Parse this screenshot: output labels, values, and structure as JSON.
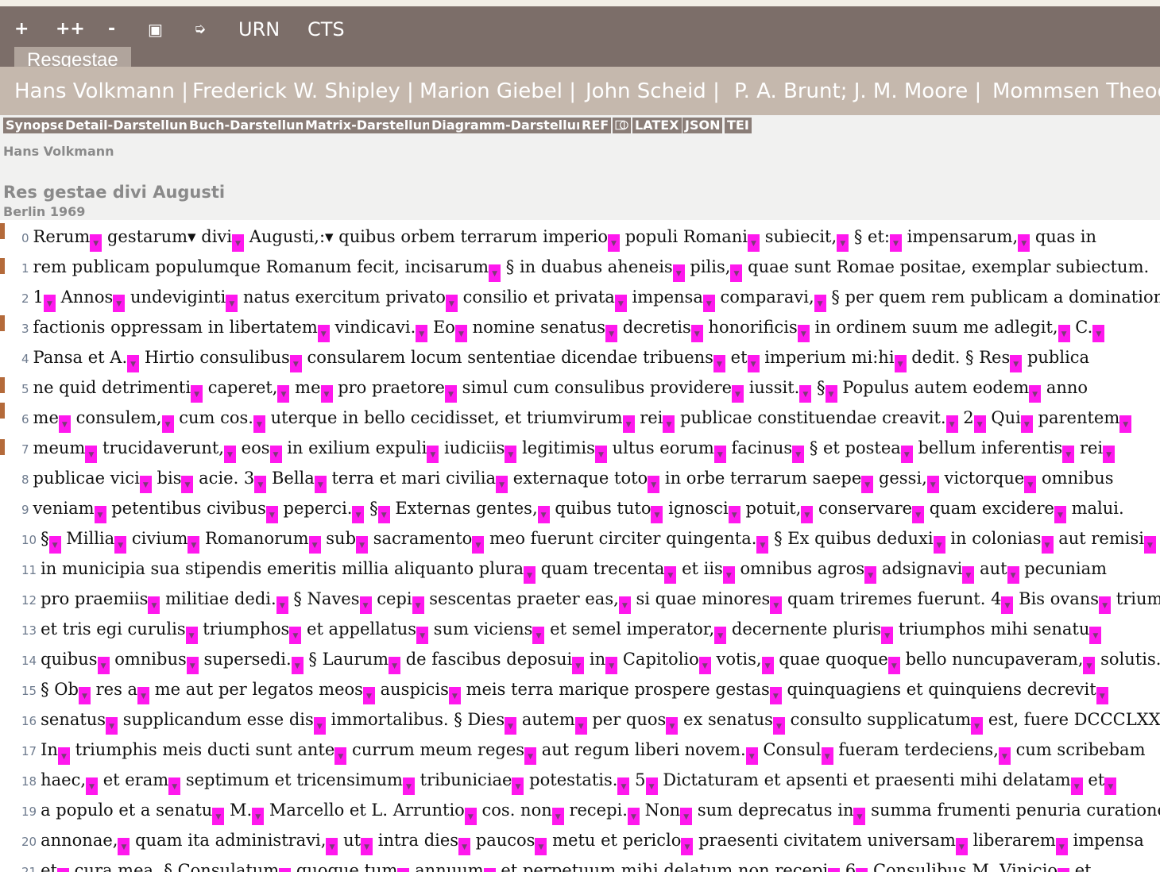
{
  "toolbar": {
    "buttons": [
      "+",
      "++",
      "-",
      "▣",
      "➭",
      "URN",
      "CTS"
    ],
    "tab_label": "Resgestae"
  },
  "translators": [
    "Hans Volkmann |",
    "Frederick W. Shipley |",
    "Marion Giebel |",
    "John Scheid |",
    "P. A. Brunt; J. M. Moore |",
    "Mommsen Theodor"
  ],
  "view_buttons": [
    "Synopse",
    "Detail-Darstellung",
    "Buch-Darstellung",
    "Matrix-Darstellung",
    "Diagramm-Darstellung",
    "REF",
    "⎄",
    "LATEX",
    "JSON",
    "TEI"
  ],
  "author": "Hans Volkmann",
  "work_title": "Res gestae divi Augusti",
  "edition": "Berlin 1969",
  "marker_glyph": "▼",
  "lines": [
    {
      "n": "0",
      "segs": [
        "Rerum",
        "gestarum▾ divi",
        "Augusti,:▾ quibus orbem terrarum imperio",
        "populi Romani",
        "subiecit,",
        "§ et:",
        "impensarum,",
        "quas in"
      ]
    },
    {
      "n": "1",
      "segs": [
        "rem publicam populumque Romanum fecit, incisarum",
        "§ in duabus aheneis",
        "pilis,",
        "quae sunt Romae positae, exemplar subiectum."
      ]
    },
    {
      "n": "2",
      "segs": [
        "1",
        "Annos",
        "undeviginti",
        "natus exercitum privato",
        "consilio et privata",
        "impensa",
        "comparavi,",
        "§ per quem rem publicam a dominatione"
      ]
    },
    {
      "n": "3",
      "segs": [
        "factionis oppressam in libertatem",
        "vindicavi.",
        "Eo",
        "nomine senatus",
        "decretis",
        "honorificis",
        "in ordinem suum me adlegit,",
        "C.",
        ""
      ]
    },
    {
      "n": "4",
      "segs": [
        "Pansa et A.",
        "Hirtio consulibus",
        "consularem locum sententiae dicendae tribuens",
        "et",
        "imperium mi:hi",
        "dedit. § Res",
        "publica"
      ]
    },
    {
      "n": "5",
      "segs": [
        "ne quid detrimenti",
        "caperet,",
        "me",
        "pro praetore",
        "simul cum consulibus providere",
        "iussit.",
        "§",
        "Populus autem eodem",
        "anno"
      ]
    },
    {
      "n": "6",
      "segs": [
        "me",
        "consulem,",
        "cum cos.",
        "uterque in bello cecidisset, et triumvirum",
        "rei",
        "publicae constituendae creavit.",
        "2",
        "Qui",
        "parentem",
        ""
      ]
    },
    {
      "n": "7",
      "segs": [
        "meum",
        "trucidaverunt,",
        "eos",
        "in exilium expuli",
        "iudiciis",
        "legitimis",
        "ultus eorum",
        "facinus",
        "§ et postea",
        "bellum inferentis",
        "rei",
        ""
      ]
    },
    {
      "n": "8",
      "segs": [
        "publicae vici",
        "bis",
        "acie. 3",
        "Bella",
        "terra et mari civilia",
        "externaque toto",
        "in orbe terrarum saepe",
        "gessi,",
        "victorque",
        "omnibus"
      ]
    },
    {
      "n": "9",
      "segs": [
        "veniam",
        "petentibus civibus",
        "peperci.",
        "§",
        "Externas gentes,",
        "quibus tuto",
        "ignosci",
        "potuit,",
        "conservare",
        "quam excidere",
        "malui."
      ]
    },
    {
      "n": "10",
      "segs": [
        "§",
        "Millia",
        "civium",
        "Romanorum",
        "sub",
        "sacramento",
        "meo fuerunt circiter quingenta.",
        "§ Ex quibus deduxi",
        "in colonias",
        "aut remisi",
        ""
      ]
    },
    {
      "n": "11",
      "segs": [
        "in municipia sua stipendis emeritis millia aliquanto plura",
        "quam trecenta",
        "et iis",
        "omnibus agros",
        "adsignavi",
        "aut",
        "pecuniam"
      ]
    },
    {
      "n": "12",
      "segs": [
        "pro praemiis",
        "militiae dedi.",
        "§ Naves",
        "cepi",
        "sescentas praeter eas,",
        "si quae minores",
        "quam triremes fuerunt. 4",
        "Bis ovans",
        "triumphavi"
      ]
    },
    {
      "n": "13",
      "segs": [
        "et tris egi curulis",
        "triumphos",
        "et appellatus",
        "sum viciens",
        "et semel imperator,",
        "decernente pluris",
        "triumphos mihi senatu",
        ""
      ]
    },
    {
      "n": "14",
      "segs": [
        "quibus",
        "omnibus",
        "supersedi.",
        "§ Laurum",
        "de fascibus deposui",
        "in",
        "Capitolio",
        "votis,",
        "quae quoque",
        "bello nuncupaveram,",
        "solutis.",
        ""
      ]
    },
    {
      "n": "15",
      "segs": [
        "§ Ob",
        "res a",
        "me aut per legatos meos",
        "auspicis",
        "meis terra marique prospere gestas",
        "quinquagiens et quinquiens decrevit",
        ""
      ]
    },
    {
      "n": "16",
      "segs": [
        "senatus",
        "supplicandum esse dis",
        "immortalibus. § Dies",
        "autem",
        "per quos",
        "ex senatus",
        "consulto supplicatum",
        "est, fuere DCCCLXXXX."
      ]
    },
    {
      "n": "17",
      "segs": [
        "In",
        "triumphis meis ducti sunt ante",
        "currum meum reges",
        "aut regum liberi novem.",
        "Consul",
        "fueram terdeciens,",
        "cum scribebam"
      ]
    },
    {
      "n": "18",
      "segs": [
        "haec,",
        "et eram",
        "septimum et tricensimum",
        "tribuniciae",
        "potestatis.",
        "5",
        "Dictaturam et apsenti et praesenti mihi delatam",
        "et",
        ""
      ]
    },
    {
      "n": "19",
      "segs": [
        "a populo et a senatu",
        "M.",
        "Marcello et L. Arruntio",
        "cos. non",
        "recepi.",
        "Non",
        "sum deprecatus in",
        "summa frumenti penuria curationem"
      ]
    },
    {
      "n": "20",
      "segs": [
        "annonae,",
        "quam ita administravi,",
        "ut",
        "intra dies",
        "paucos",
        "metu et periclo",
        "praesenti civitatem universam",
        "liberarem",
        "impensa"
      ]
    },
    {
      "n": "21",
      "segs": [
        "et",
        "cura mea. § Consulatum",
        "quoque tum",
        "annuum",
        "et perpetuum mihi delatum non recepi",
        "6",
        "Consulibus M. Vinicio",
        "et"
      ]
    }
  ]
}
